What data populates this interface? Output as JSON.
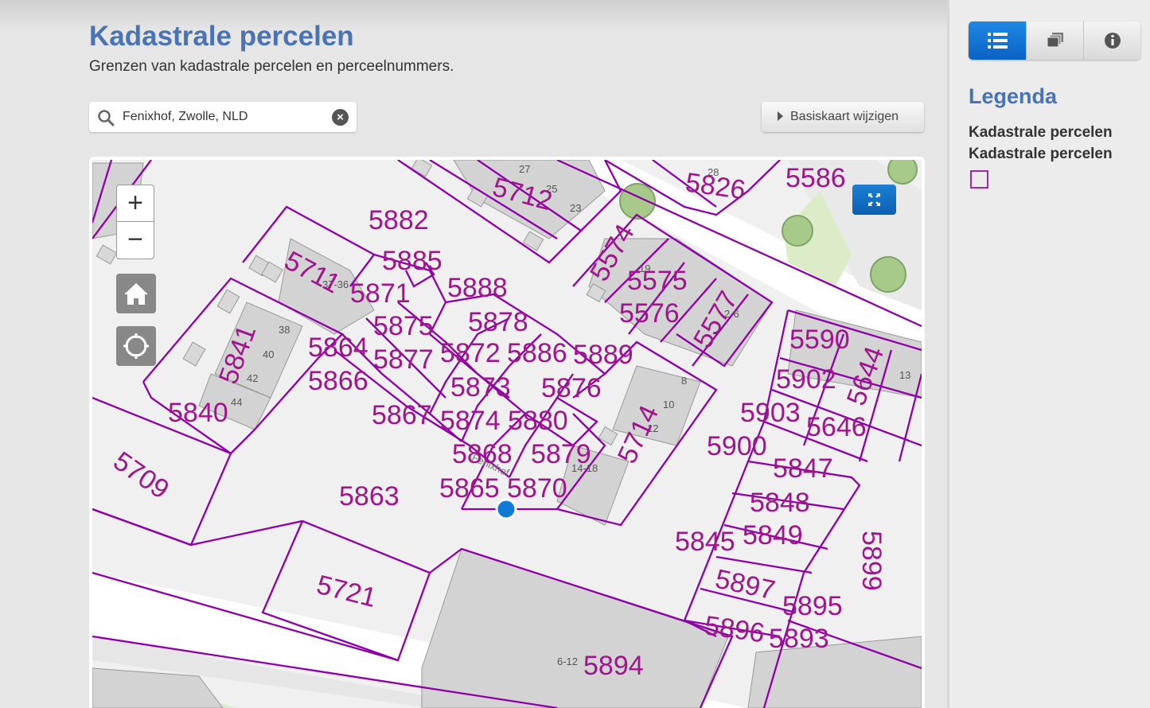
{
  "header": {
    "title": "Kadastrale percelen",
    "subtitle": "Grenzen van kadastrale percelen en perceelnummers."
  },
  "search": {
    "value": "Fenixhof, Zwolle, NLD"
  },
  "basemap_button": {
    "label": "Basiskaart wijzigen"
  },
  "map": {
    "controls": {
      "zoom_in": "+",
      "zoom_out": "−"
    },
    "parcel_labels": [
      {
        "t": "5882"
      },
      {
        "t": "5885"
      },
      {
        "t": "5888"
      },
      {
        "t": "5878"
      },
      {
        "t": "5875"
      },
      {
        "t": "5871"
      },
      {
        "t": "5711"
      },
      {
        "t": "5864"
      },
      {
        "t": "5877"
      },
      {
        "t": "5872"
      },
      {
        "t": "5886"
      },
      {
        "t": "5889"
      },
      {
        "t": "5866"
      },
      {
        "t": "5873"
      },
      {
        "t": "5876"
      },
      {
        "t": "5840"
      },
      {
        "t": "5867"
      },
      {
        "t": "5874"
      },
      {
        "t": "5880"
      },
      {
        "t": "5868"
      },
      {
        "t": "5879"
      },
      {
        "t": "5863"
      },
      {
        "t": "5865"
      },
      {
        "t": "5870"
      },
      {
        "t": "5900"
      },
      {
        "t": "5903"
      },
      {
        "t": "5902"
      },
      {
        "t": "5590"
      },
      {
        "t": "5847"
      },
      {
        "t": "5848"
      },
      {
        "t": "5849"
      },
      {
        "t": "5845"
      },
      {
        "t": "5897"
      },
      {
        "t": "5895"
      },
      {
        "t": "5896"
      },
      {
        "t": "5893"
      },
      {
        "t": "5894"
      },
      {
        "t": "5721"
      },
      {
        "t": "5826"
      },
      {
        "t": "5586"
      },
      {
        "t": "5575"
      },
      {
        "t": "5576"
      },
      {
        "t": "5712"
      },
      {
        "t": "5646"
      },
      {
        "t": "5644"
      },
      {
        "t": "5577"
      },
      {
        "t": "5574"
      },
      {
        "t": "5714"
      },
      {
        "t": "5841"
      },
      {
        "t": "5709"
      },
      {
        "t": "5899"
      }
    ],
    "house_numbers": [
      "27",
      "25",
      "23",
      "38",
      "40",
      "42",
      "44",
      "37-36",
      "19",
      "2-6",
      "8",
      "10",
      "12",
      "14-18",
      "13",
      "6-12",
      "28"
    ],
    "street_label": "Fenixhof"
  },
  "sidebar": {
    "tabs": [
      {
        "name": "legend",
        "icon": "list-icon"
      },
      {
        "name": "layers",
        "icon": "layers-icon"
      },
      {
        "name": "about",
        "icon": "info-icon"
      }
    ],
    "legend_title": "Legenda",
    "layer_group": "Kadastrale percelen",
    "layer_name": "Kadastrale percelen",
    "colors": {
      "parcel_line": "#8e00a8",
      "parcel_label": "#a0148c",
      "accent": "#4a73b5"
    }
  }
}
